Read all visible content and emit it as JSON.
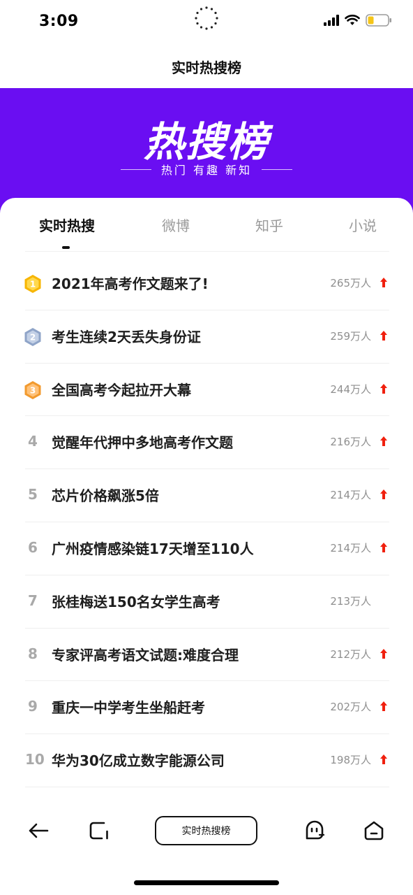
{
  "status": {
    "time": "3:09"
  },
  "header": {
    "title": "实时热搜榜"
  },
  "banner": {
    "logo": "热搜榜",
    "subtitle": "热门 有趣 新知",
    "bg_color": "#6a0ef2"
  },
  "tabs": [
    {
      "label": "实时热搜",
      "active": true
    },
    {
      "label": "微博",
      "active": false
    },
    {
      "label": "知乎",
      "active": false
    },
    {
      "label": "小说",
      "active": false
    }
  ],
  "list": [
    {
      "rank": "1",
      "title": "2021年高考作文题来了!",
      "count": "265万人",
      "trend": "up",
      "medal": "gold"
    },
    {
      "rank": "2",
      "title": "考生连续2天丢失身份证",
      "count": "259万人",
      "trend": "up",
      "medal": "silver"
    },
    {
      "rank": "3",
      "title": "全国高考今起拉开大幕",
      "count": "244万人",
      "trend": "up",
      "medal": "bronze"
    },
    {
      "rank": "4",
      "title": "觉醒年代押中多地高考作文题",
      "count": "216万人",
      "trend": "up"
    },
    {
      "rank": "5",
      "title": "芯片价格飙涨5倍",
      "count": "214万人",
      "trend": "up"
    },
    {
      "rank": "6",
      "title": "广州疫情感染链17天增至110人",
      "count": "214万人",
      "trend": "up"
    },
    {
      "rank": "7",
      "title": "张桂梅送150名女学生高考",
      "count": "213万人",
      "trend": "none"
    },
    {
      "rank": "8",
      "title": "专家评高考语文试题:难度合理",
      "count": "212万人",
      "trend": "up"
    },
    {
      "rank": "9",
      "title": "重庆一中学考生坐船赶考",
      "count": "202万人",
      "trend": "up"
    },
    {
      "rank": "10",
      "title": "华为30亿成立数字能源公司",
      "count": "198万人",
      "trend": "up"
    }
  ],
  "toolbar": {
    "center_label": "实时热搜榜",
    "icons": [
      "back-arrow-icon",
      "tabs-icon",
      "assistant-icon",
      "home-icon"
    ]
  },
  "colors": {
    "trend_up": "#f0200e",
    "gold": "#f7b500",
    "silver": "#8fa4c8",
    "bronze": "#f29a2e"
  }
}
